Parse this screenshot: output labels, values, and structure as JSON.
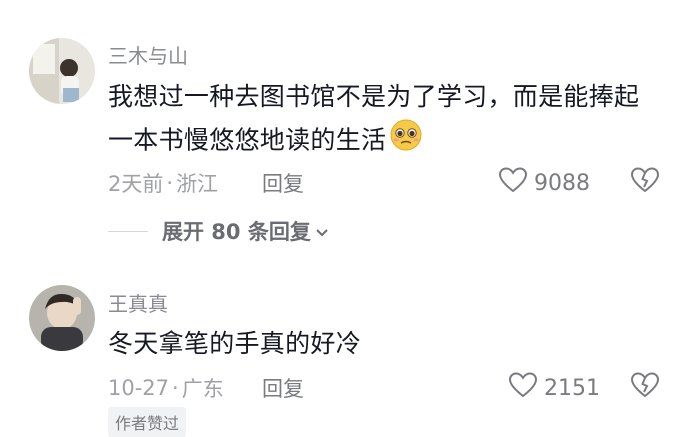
{
  "comments": [
    {
      "username": "三木与山",
      "text_line1": "我想过一种去图书馆不是为了学习，而是能捧起",
      "text_line2": "一本书慢悠悠地读的生活",
      "emoji": "pleading-face-emoji",
      "time": "2天前",
      "location": "浙江",
      "reply_label": "回复",
      "likes": "9088",
      "expand_label": "展开 80 条回复"
    },
    {
      "username": "王真真",
      "text": "冬天拿笔的手真的好冷",
      "time": "10-27",
      "location": "广东",
      "reply_label": "回复",
      "likes": "2151",
      "badge": "作者赞过"
    }
  ],
  "separator": "·",
  "colors": {
    "text": "#161823",
    "muted": "#8a8b91",
    "icon": "#7a7b80"
  }
}
